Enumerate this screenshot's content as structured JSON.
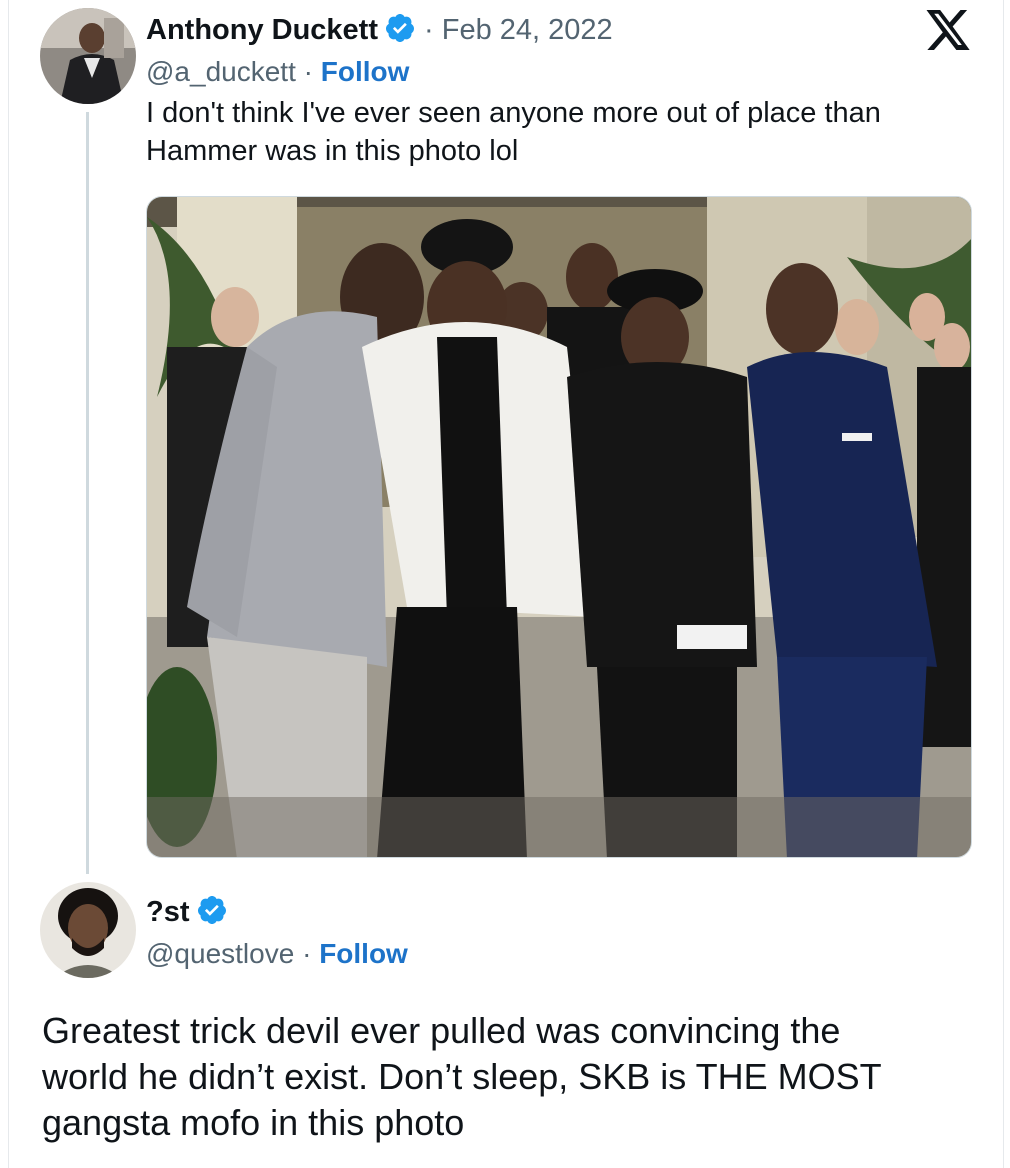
{
  "tweet": {
    "author_name": "Anthony Duckett",
    "date": "Feb 24, 2022",
    "handle": "@a_duckett",
    "follow_label": "Follow",
    "separator": "·",
    "text_line1": "I don't think I've ever seen anyone more out of place than",
    "text_line2": "Hammer was in this photo lol"
  },
  "reply": {
    "author_name": "?st",
    "handle": "@questlove",
    "follow_label": "Follow",
    "separator": "·",
    "text_line1": "Greatest trick devil ever pulled was convincing the",
    "text_line2": "world he didn’t exist. Don’t sleep, SKB is THE MOST",
    "text_line3": "gangsta mofo in this photo"
  },
  "icons": {
    "close": "x-logo-icon",
    "verified": "verified-badge-icon"
  },
  "colors": {
    "follow": "#1d73c9",
    "verified": "#1d9bf0",
    "secondary_text": "#536471"
  }
}
